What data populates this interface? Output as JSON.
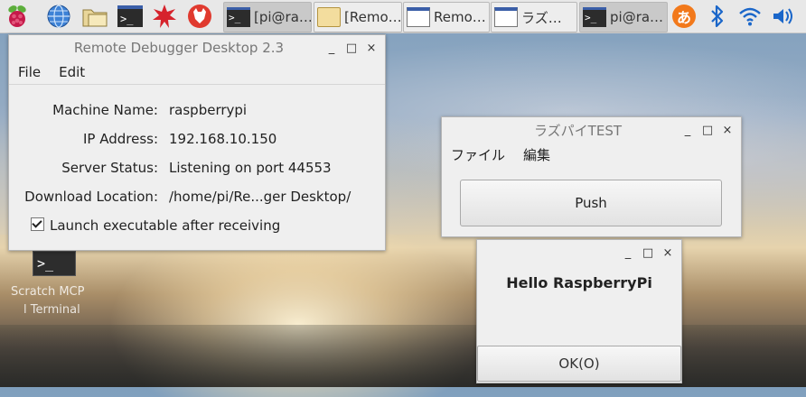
{
  "taskbar": {
    "tasks": [
      {
        "label": "[pi@ra…",
        "icon": "terminal-icon"
      },
      {
        "label": "[Remo…",
        "icon": "folder-icon"
      },
      {
        "label": "Remo…",
        "icon": "window-icon"
      },
      {
        "label": "ラズ…",
        "icon": "window-icon"
      },
      {
        "label": "pi@ra…",
        "icon": "terminal-icon"
      }
    ],
    "ime_label": "あ",
    "colors": {
      "accent": "#3a5ea8",
      "ime": "#f2791b",
      "bluetooth": "#1a66c9"
    }
  },
  "desktop": {
    "icon_glyph": ">_",
    "label_1": "Scratch MCP",
    "label_2": "l Terminal"
  },
  "debugger_window": {
    "title": "Remote Debugger Desktop 2.3",
    "menu": {
      "file": "File",
      "edit": "Edit"
    },
    "fields": [
      {
        "label": "Machine Name:",
        "value": "raspberrypi"
      },
      {
        "label": "IP Address:",
        "value": "192.168.10.150"
      },
      {
        "label": "Server Status:",
        "value": "Listening on port 44553"
      },
      {
        "label": "Download Location:",
        "value": "/home/pi/Re...ger Desktop/"
      }
    ],
    "checkbox_label": "Launch executable after receiving",
    "checkbox_checked": true
  },
  "test_window": {
    "title": "ラズパイTEST",
    "menu": {
      "file": "ファイル",
      "edit": "編集"
    },
    "push_label": "Push"
  },
  "message_dialog": {
    "message": "Hello RaspberryPi",
    "ok_label": "OK(O)"
  },
  "window_controls": {
    "minimize": "_",
    "maximize": "□",
    "close": "×"
  }
}
